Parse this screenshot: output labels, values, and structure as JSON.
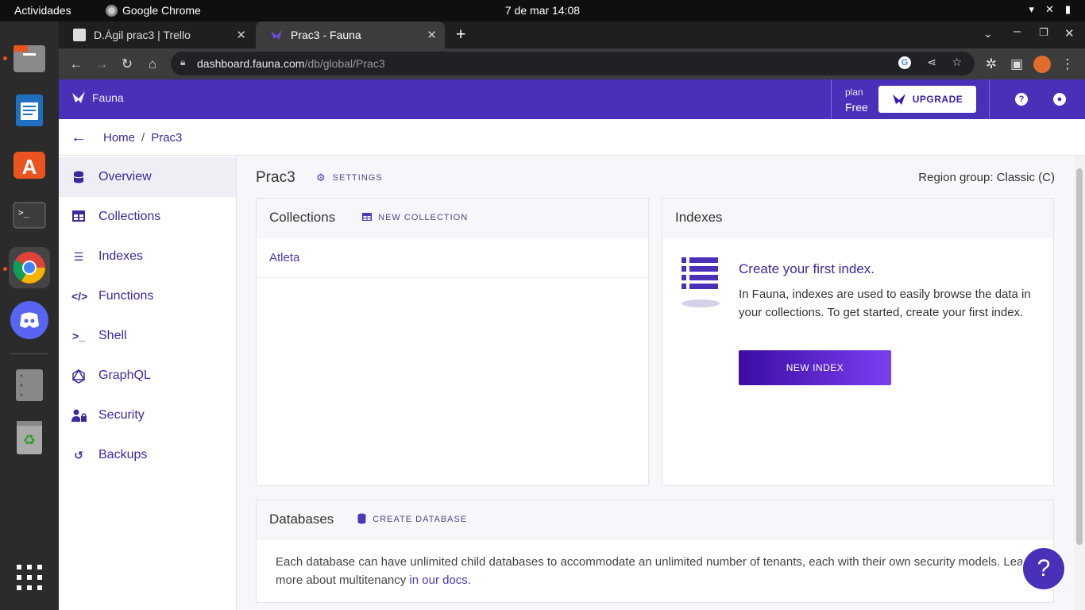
{
  "system": {
    "activities": "Actividades",
    "app_name": "Google Chrome",
    "clock": "7 de mar  14:08"
  },
  "browser": {
    "tabs": [
      {
        "title": "D.Ágil prac3 | Trello",
        "active": false
      },
      {
        "title": "Prac3 - Fauna",
        "active": true
      }
    ],
    "url_host": "dashboard.fauna.com",
    "url_path": "/db/global/Prac3"
  },
  "header": {
    "logo_text": "Fauna",
    "plan_label": "plan",
    "plan_value": "Free",
    "upgrade_label": "UPGRADE"
  },
  "breadcrumb": {
    "home": "Home",
    "sep": "/",
    "current": "Prac3"
  },
  "sidebar": {
    "items": [
      {
        "label": "Overview",
        "icon": "database-icon",
        "selected": true
      },
      {
        "label": "Collections",
        "icon": "table-icon"
      },
      {
        "label": "Indexes",
        "icon": "list-icon"
      },
      {
        "label": "Functions",
        "icon": "code-icon"
      },
      {
        "label": "Shell",
        "icon": "terminal-icon"
      },
      {
        "label": "GraphQL",
        "icon": "graphql-icon"
      },
      {
        "label": "Security",
        "icon": "user-lock-icon"
      },
      {
        "label": "Backups",
        "icon": "history-icon"
      }
    ]
  },
  "main": {
    "db_name": "Prac3",
    "settings_label": "SETTINGS",
    "region": "Region group: Classic (C)",
    "collections": {
      "title": "Collections",
      "action": "NEW COLLECTION",
      "rows": [
        "Atleta"
      ]
    },
    "indexes": {
      "title": "Indexes",
      "empty_title": "Create your first index.",
      "empty_desc": "In Fauna, indexes are used to easily browse the data in your collections. To get started, create your first index.",
      "button": "NEW INDEX"
    },
    "databases": {
      "title": "Databases",
      "action": "CREATE DATABASE",
      "desc": "Each database can have unlimited child databases to accommodate an unlimited number of tenants, each with their own security models. Learn more about multitenancy ",
      "link": "in our docs",
      "desc_end": "."
    }
  },
  "colors": {
    "brand": "#4a2fb9",
    "link": "#3b2a9e"
  }
}
